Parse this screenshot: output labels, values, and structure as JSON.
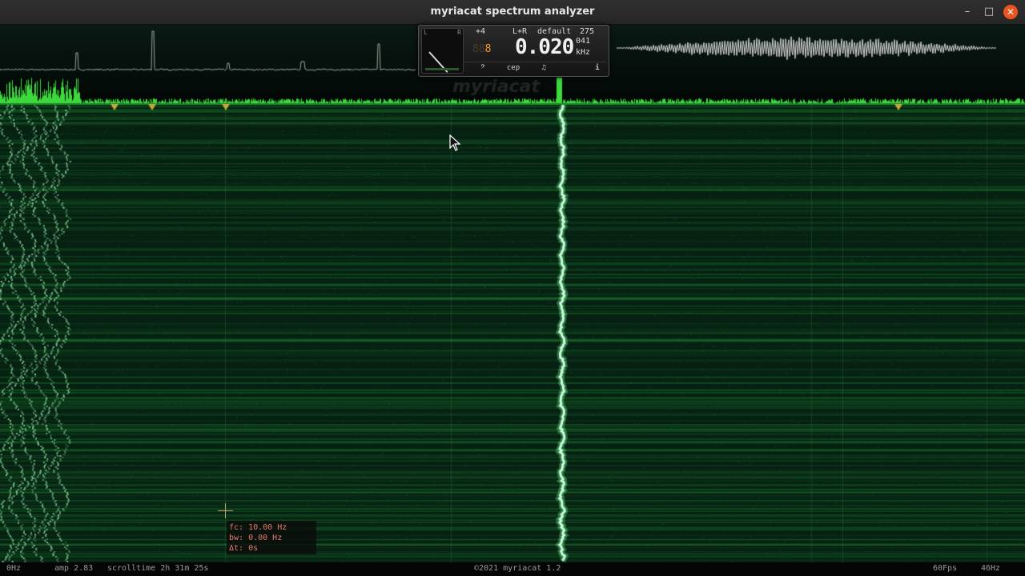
{
  "window": {
    "title": "myriacat spectrum analyzer",
    "minimize": "–",
    "maximize": "□",
    "close": "✕"
  },
  "panel": {
    "gauge_left": "L",
    "gauge_right": "R",
    "transpose": "+4",
    "channel": "L+R",
    "preset": "default",
    "preset_value": "275",
    "dim_digits": "88",
    "orange_digit": "8",
    "frequency": "0.020",
    "cents": "041",
    "unit": "kHz",
    "tabs": [
      "𝄢",
      "cep",
      "♫"
    ],
    "info": "i"
  },
  "readout": {
    "fc": "fc: 10.00 Hz",
    "bw": "bw: 0.00 Hz",
    "dt": "Δt: 0s"
  },
  "statusbar": {
    "left_freq": "0Hz",
    "amp": "amp 2.83",
    "scrolltime": "scrolltime 2h 31m 25s",
    "copyright": "©2021 myriacat 1.2",
    "fps": "60Fps",
    "right_freq": "46Hz"
  },
  "watermark": "myriacat",
  "colors": {
    "spectrum_green": "#3cd83c",
    "marker_gold": "#c9a63a",
    "close_button": "#e95420"
  }
}
